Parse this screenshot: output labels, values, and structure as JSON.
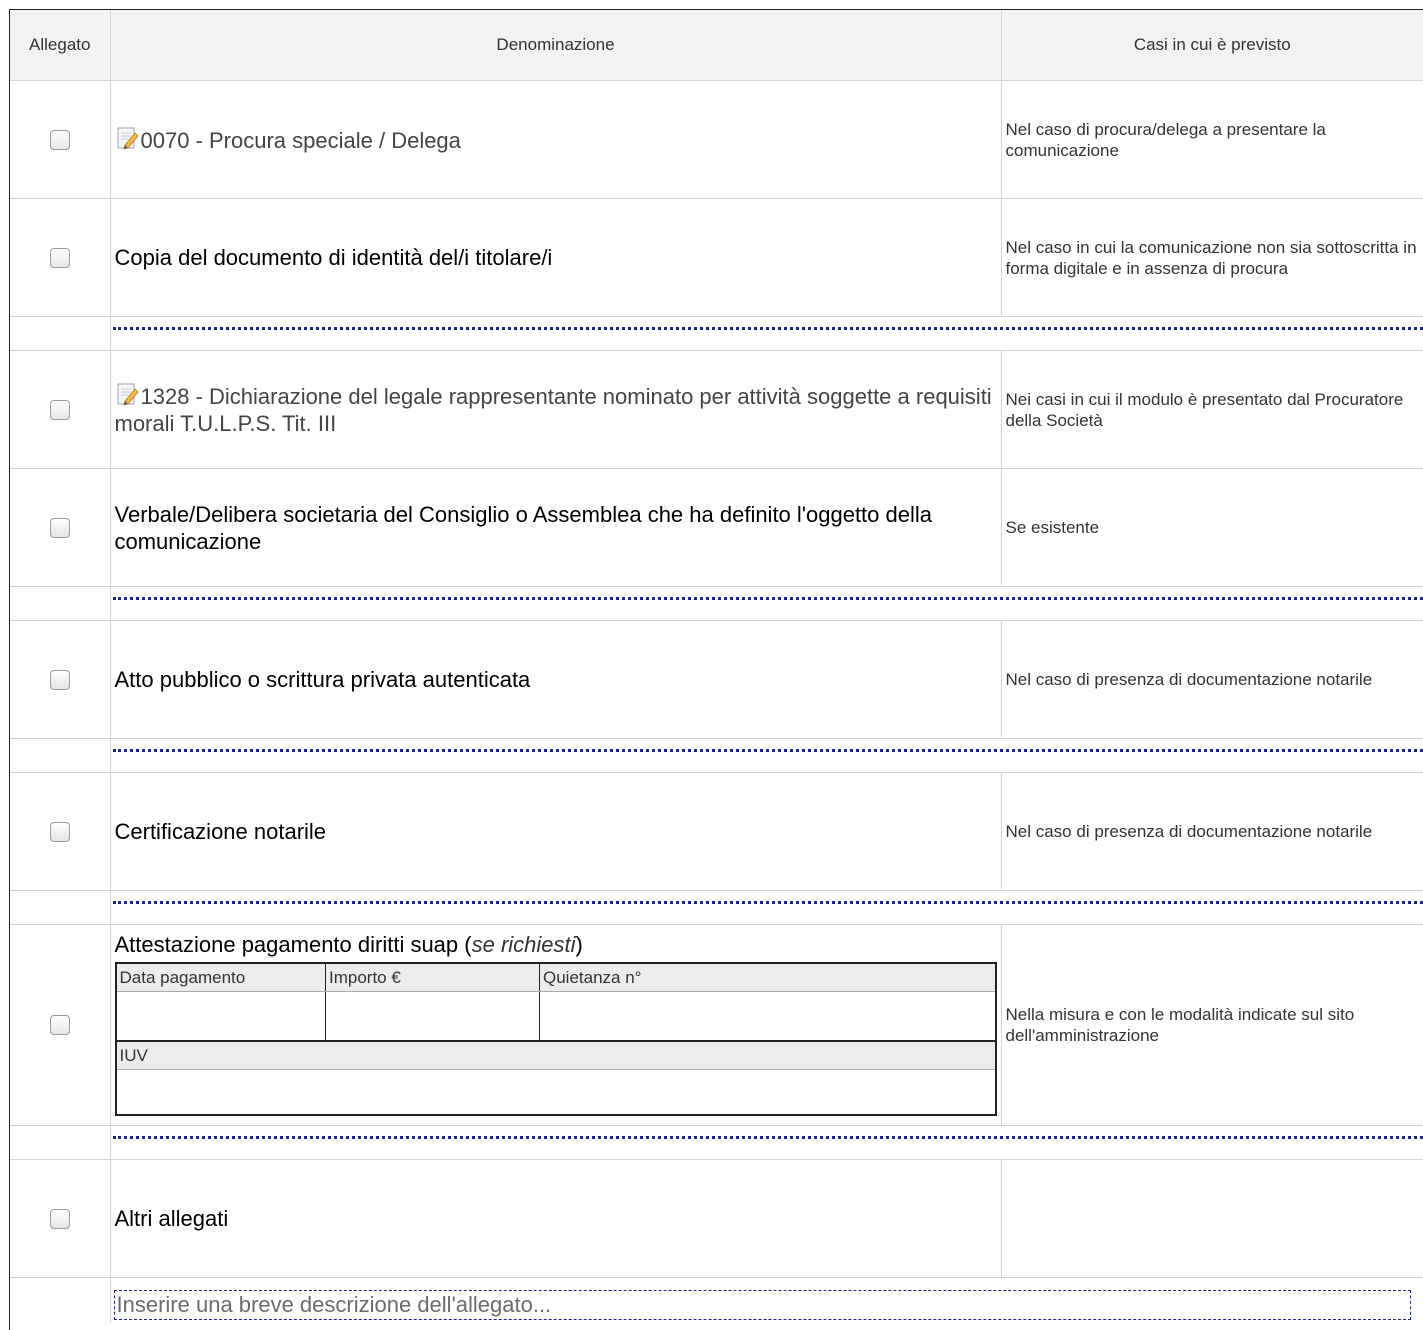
{
  "headers": {
    "allegato": "Allegato",
    "denominazione": "Denominazione",
    "casi": "Casi in cui è previsto"
  },
  "rows": [
    {
      "name": "0070 - Procura speciale / Delega",
      "cases": "Nel caso di procura/delega a presentare la comunicazione",
      "icon": "document-edit-icon"
    },
    {
      "name": "Copia del documento di identità del/i titolare/i",
      "cases": "Nel caso in cui la comunicazione non sia sottoscritta in forma digitale e in assenza di procura"
    },
    {
      "name": "1328 - Dichiarazione del legale rappresentante nominato per attività soggette a requisiti morali T.U.L.P.S. Tit. III",
      "cases": "Nei casi in cui il modulo è presentato dal Procuratore della Società",
      "icon": "document-edit-icon"
    },
    {
      "name": "Verbale/Delibera societaria del Consiglio o Assemblea che ha definito l'oggetto della comunicazione",
      "cases": "Se esistente"
    },
    {
      "name": "Atto pubblico o scrittura privata autenticata",
      "cases": "Nel caso di presenza di documentazione notarile"
    },
    {
      "name": "Certificazione notarile",
      "cases": "Nel caso di presenza di documentazione notarile"
    }
  ],
  "payment": {
    "title": "Attestazione pagamento diritti suap (",
    "title_italic": "se richiesti",
    "title_end": ")",
    "cases": "Nella misura e con le modalità indicate sul sito dell'amministrazione",
    "labels": {
      "data": "Data pagamento",
      "importo": "Importo €",
      "quietanza": "Quietanza n°",
      "iuv": "IUV"
    }
  },
  "altri": {
    "name": "Altri allegati",
    "cases": "",
    "description_placeholder": "Inserire una breve descrizione dell'allegato..."
  },
  "colors": {
    "separator": "#1a237e",
    "grid": "#d4d4d4",
    "header_bg": "#f2f2f2"
  }
}
